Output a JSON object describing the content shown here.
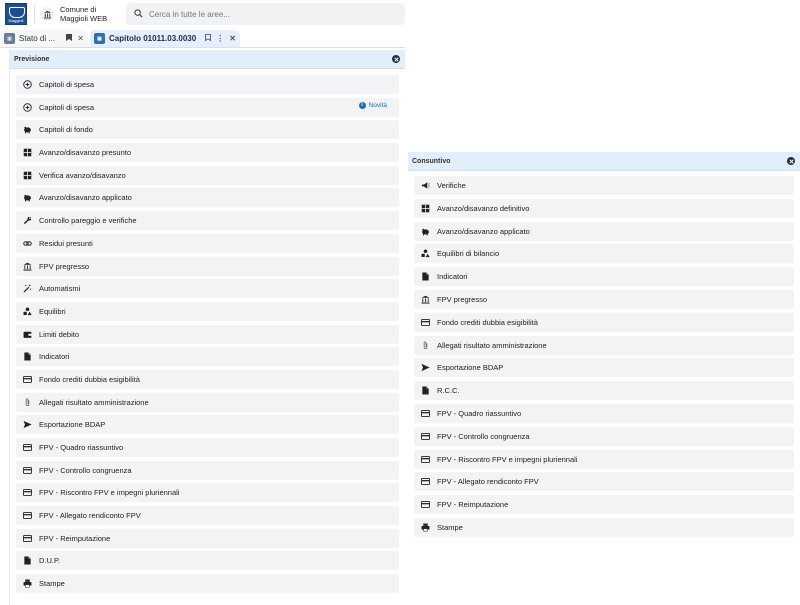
{
  "header": {
    "logo_text": "Maggioli",
    "ente_line1": "Comune di",
    "ente_line2": "Maggioli WEB",
    "search_placeholder": "Cerca in tutte le aree..."
  },
  "tabs": [
    {
      "label": "Stato di ...",
      "active": false
    },
    {
      "label": "Capitolo 01011.03.0030",
      "active": true
    }
  ],
  "previsione": {
    "title": "Previsione",
    "items": [
      {
        "label": "Capitoli di spesa",
        "icon": "plus-circle-icon"
      },
      {
        "label": "Capitoli di spesa",
        "icon": "plus-circle-icon",
        "badge": "Novità"
      },
      {
        "label": "Capitoli di fondo",
        "icon": "piggy-bank-icon"
      },
      {
        "label": "Avanzo/disavanzo presunto",
        "icon": "table-icon"
      },
      {
        "label": "Verifica avanzo/disavanzo",
        "icon": "table-icon"
      },
      {
        "label": "Avanzo/disavanzo applicato",
        "icon": "piggy-bank-icon"
      },
      {
        "label": "Controllo pareggio e verifiche",
        "icon": "wrench-icon"
      },
      {
        "label": "Residui presunti",
        "icon": "link-icon"
      },
      {
        "label": "FPV pregresso",
        "icon": "bank-icon"
      },
      {
        "label": "Automatismi",
        "icon": "magic-wand-icon"
      },
      {
        "label": "Equilibri",
        "icon": "shapes-icon"
      },
      {
        "label": "Limiti debito",
        "icon": "wallet-icon"
      },
      {
        "label": "Indicatori",
        "icon": "file-icon"
      },
      {
        "label": "Fondo crediti dubbia esigibilità",
        "icon": "credit-card-icon"
      },
      {
        "label": "Allegati risultato amministrazione",
        "icon": "paperclip-icon"
      },
      {
        "label": "Esportazione BDAP",
        "icon": "send-icon"
      },
      {
        "label": "FPV - Quadro riassuntivo",
        "icon": "credit-card-icon"
      },
      {
        "label": "FPV - Controllo congruenza",
        "icon": "credit-card-icon"
      },
      {
        "label": "FPV - Riscontro FPV e impegni pluriennali",
        "icon": "credit-card-icon"
      },
      {
        "label": "FPV - Allegato rendiconto FPV",
        "icon": "credit-card-icon"
      },
      {
        "label": "FPV - Reimputazione",
        "icon": "credit-card-icon"
      },
      {
        "label": "D.U.P.",
        "icon": "file-icon"
      },
      {
        "label": "Stampe",
        "icon": "printer-icon"
      }
    ]
  },
  "consuntivo": {
    "title": "Consuntivo",
    "items": [
      {
        "label": "Verifiche",
        "icon": "megaphone-icon"
      },
      {
        "label": "Avanzo/disavanzo definitivo",
        "icon": "table-icon"
      },
      {
        "label": "Avanzo/disavanzo applicato",
        "icon": "piggy-bank-icon"
      },
      {
        "label": "Equilibri di bilancio",
        "icon": "shapes-icon"
      },
      {
        "label": "Indicatori",
        "icon": "file-icon"
      },
      {
        "label": "FPV pregresso",
        "icon": "bank-icon"
      },
      {
        "label": "Fondo crediti dubbia esigibilità",
        "icon": "credit-card-icon"
      },
      {
        "label": "Allegati risultato amministrazione",
        "icon": "paperclip-icon"
      },
      {
        "label": "Esportazione BDAP",
        "icon": "send-icon"
      },
      {
        "label": "R.C.C.",
        "icon": "file-icon"
      },
      {
        "label": "FPV - Quadro riassuntivo",
        "icon": "credit-card-icon"
      },
      {
        "label": "FPV - Controllo congruenza",
        "icon": "credit-card-icon"
      },
      {
        "label": "FPV - Riscontro FPV e impegni pluriennali",
        "icon": "credit-card-icon"
      },
      {
        "label": "FPV - Allegato rendiconto FPV",
        "icon": "credit-card-icon"
      },
      {
        "label": "FPV - Reimputazione",
        "icon": "credit-card-icon"
      },
      {
        "label": "Stampe",
        "icon": "printer-icon"
      }
    ]
  }
}
